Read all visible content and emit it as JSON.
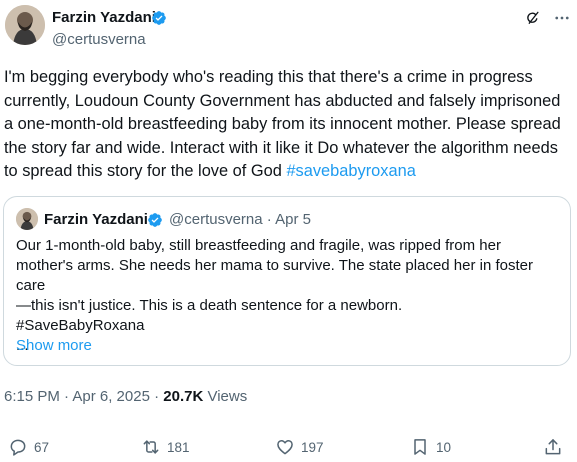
{
  "author": {
    "name": "Farzin Yazdani",
    "handle": "@certusverna"
  },
  "tweet": {
    "text": "I'm begging everybody who's reading this that there's a crime in progress currently, Loudoun County Government has abducted and falsely imprisoned a one-month-old breastfeeding baby from its innocent mother. Please spread the story far and wide. Interact with it like it Do whatever the algorithm needs to spread this story for the love of God ",
    "hashtag": "#savebabyroxana"
  },
  "quote": {
    "name": "Farzin Yazdani",
    "handle_date": "@certusverna · Apr 5",
    "lines": [
      "Our 1-month-old baby, still breastfeeding and fragile, was ripped from her",
      "mother's arms. She needs her mama to survive. The state placed her in foster care",
      "—this isn't justice. This is a death sentence for a newborn.",
      "#SaveBabyRoxana",
      "..."
    ],
    "show_more": "Show more"
  },
  "meta": {
    "time": "6:15 PM · Apr 6, 2025 · ",
    "views_count": "20.7K",
    "views_label": " Views"
  },
  "actions": {
    "replies": "67",
    "reposts": "181",
    "likes": "197",
    "bookmarks": "10"
  },
  "colors": {
    "accent": "#1d9bf0",
    "text": "#0f1419",
    "secondary": "#536471",
    "border": "#cfd9de"
  }
}
